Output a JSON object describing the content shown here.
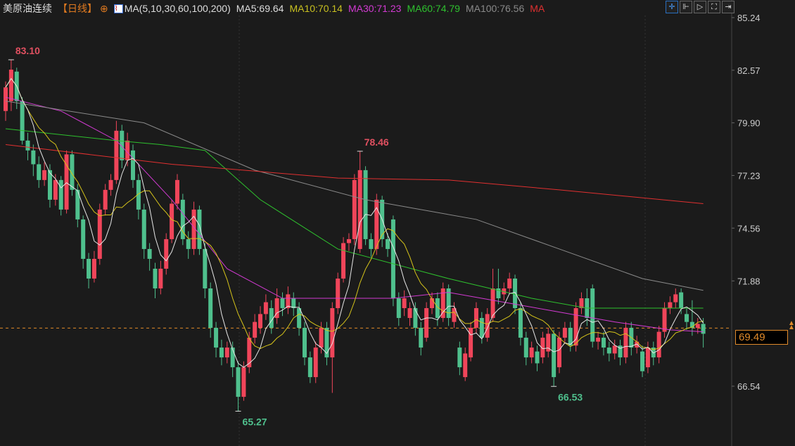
{
  "header": {
    "title": "美原油连续",
    "period": "【日线】",
    "ma_label": "MA(5,10,30,60,100,200)",
    "ma5": "MA5:69.64",
    "ma10": "MA10:70.14",
    "ma30": "MA30:71.23",
    "ma60": "MA60:74.79",
    "ma100": "MA100:76.56",
    "ma200": "MA"
  },
  "colors": {
    "up": "#f0455a",
    "down": "#4fc08d",
    "ma5": "#e6e6e6",
    "ma10": "#d6c41a",
    "ma30": "#d23ad2",
    "ma60": "#2ec02e",
    "ma100": "#8a8a8a",
    "ma200": "#e03030",
    "price": "#e08a2a"
  },
  "toolbar": [
    "crosshair-icon",
    "zoom-in-icon",
    "play-icon",
    "fullscreen-icon",
    "exit-icon"
  ],
  "current_price": "69.49",
  "chart_data": {
    "type": "candlestick",
    "yticks": [
      "85.24",
      "82.57",
      "79.90",
      "77.23",
      "74.56",
      "71.88",
      "69.49",
      "66.54"
    ],
    "ylim": [
      66.54,
      85.24
    ],
    "annotations": [
      {
        "idx": 1,
        "text": "83.10",
        "pos": "high"
      },
      {
        "idx": 64,
        "text": "78.46",
        "pos": "high"
      },
      {
        "idx": 42,
        "text": "65.27",
        "pos": "low"
      },
      {
        "idx": 99,
        "text": "66.53",
        "pos": "low"
      }
    ],
    "ohlc": [
      [
        80.5,
        81.7,
        82,
        80
      ],
      [
        81,
        82.6,
        83.1,
        80.5
      ],
      [
        82.5,
        81,
        82.7,
        80.6
      ],
      [
        81,
        79,
        81.2,
        78.8
      ],
      [
        79,
        78.5,
        79.4,
        78
      ],
      [
        78.5,
        77.8,
        78.8,
        77.2
      ],
      [
        77.8,
        77,
        78.2,
        76.6
      ],
      [
        77,
        77.5,
        77.9,
        76.7
      ],
      [
        77.5,
        76,
        77.8,
        75.6
      ],
      [
        76,
        77,
        77.3,
        75.7
      ],
      [
        77,
        75.5,
        77.2,
        75.2
      ],
      [
        75.5,
        78.3,
        78.5,
        75.3
      ],
      [
        78.3,
        76.5,
        78.5,
        76.2
      ],
      [
        76.5,
        75,
        76.8,
        74.6
      ],
      [
        75,
        73,
        75.2,
        72.5
      ],
      [
        73,
        72,
        73.3,
        71.5
      ],
      [
        72,
        73,
        73.4,
        71.8
      ],
      [
        73,
        75.5,
        75.8,
        72.7
      ],
      [
        75.5,
        76.5,
        76.8,
        75.2
      ],
      [
        76.5,
        77,
        77.3,
        76.2
      ],
      [
        77,
        79.5,
        80,
        76.8
      ],
      [
        79.5,
        78,
        79.8,
        77.6
      ],
      [
        78,
        79,
        79.4,
        77.7
      ],
      [
        78.5,
        77,
        78.8,
        76.6
      ],
      [
        77,
        75.5,
        77.3,
        75
      ],
      [
        75.5,
        73.5,
        75.8,
        73
      ],
      [
        73.5,
        73,
        73.8,
        72.4
      ],
      [
        72.5,
        71.5,
        72.8,
        71
      ],
      [
        71.5,
        72.5,
        72.9,
        71.2
      ],
      [
        72.5,
        74,
        74.3,
        72.2
      ],
      [
        74,
        75.8,
        76,
        73.8
      ],
      [
        75.8,
        77,
        77.3,
        75.5
      ],
      [
        76,
        74,
        76.3,
        73.7
      ],
      [
        74,
        73.5,
        74.4,
        73
      ],
      [
        73.5,
        75.5,
        75.9,
        73.2
      ],
      [
        75.5,
        73.5,
        75.7,
        73.2
      ],
      [
        73.5,
        71.5,
        73.8,
        71
      ],
      [
        71.5,
        69.5,
        71.8,
        69
      ],
      [
        69.5,
        68.5,
        69.8,
        68
      ],
      [
        68.5,
        68,
        68.9,
        67.6
      ],
      [
        68,
        68.5,
        68.8,
        67.7
      ],
      [
        68.5,
        67.5,
        68.8,
        67
      ],
      [
        67.5,
        66,
        67.8,
        65.27
      ],
      [
        66,
        67.5,
        67.8,
        65.8
      ],
      [
        67.5,
        69,
        69.3,
        67.2
      ],
      [
        69,
        69.8,
        70.2,
        68.7
      ],
      [
        69.5,
        70.2,
        70.6,
        69.2
      ],
      [
        70.2,
        70.8,
        71.2,
        69.9
      ],
      [
        70.5,
        69.5,
        70.9,
        69.2
      ],
      [
        70,
        71,
        71.5,
        69.7
      ],
      [
        71,
        70.5,
        71.3,
        70.1
      ],
      [
        70.5,
        71.2,
        71.6,
        70.2
      ],
      [
        71,
        70.5,
        71.3,
        70.1
      ],
      [
        70.5,
        69.5,
        70.8,
        69.1
      ],
      [
        69.5,
        68,
        69.8,
        67.6
      ],
      [
        68,
        67,
        68.3,
        66.7
      ],
      [
        67,
        68.5,
        68.8,
        66.7
      ],
      [
        68.5,
        69.5,
        69.8,
        68.2
      ],
      [
        69.5,
        68,
        69.8,
        67.6
      ],
      [
        68,
        70.5,
        70.8,
        66.2
      ],
      [
        70.5,
        72,
        72.3,
        70.2
      ],
      [
        72,
        73.8,
        74.1,
        71.8
      ],
      [
        73.8,
        74,
        74.3,
        73.4
      ],
      [
        74,
        77,
        77.3,
        73.7
      ],
      [
        73.5,
        77.5,
        78.46,
        73.3
      ],
      [
        77.5,
        74,
        77.7,
        73.7
      ],
      [
        74,
        73.5,
        74.3,
        73.1
      ],
      [
        73.5,
        76,
        76.3,
        73.2
      ],
      [
        76,
        74,
        76.2,
        73.6
      ],
      [
        74,
        73.5,
        74.3,
        73.1
      ],
      [
        75,
        71,
        75.2,
        70.6
      ],
      [
        71,
        70,
        71.3,
        69.6
      ],
      [
        70.5,
        71,
        71.4,
        70.1
      ],
      [
        70,
        70.5,
        70.8,
        69.6
      ],
      [
        70.5,
        69.5,
        70.8,
        69.1
      ],
      [
        69.5,
        68.5,
        69.8,
        68.1
      ],
      [
        69,
        70.5,
        70.8,
        68.8
      ],
      [
        70.5,
        71,
        71.3,
        70.2
      ],
      [
        71,
        70,
        71.3,
        69.6
      ],
      [
        70,
        71.5,
        71.8,
        69.8
      ],
      [
        71.5,
        70,
        71.7,
        69.6
      ],
      [
        69.8,
        70.5,
        70.8,
        69.5
      ],
      [
        68.5,
        67.5,
        68.8,
        67.1
      ],
      [
        67,
        68.2,
        68.5,
        66.8
      ],
      [
        68,
        69.5,
        69.8,
        67.8
      ],
      [
        69.5,
        70.5,
        70.8,
        69.2
      ],
      [
        70,
        69,
        70.3,
        68.7
      ],
      [
        69,
        70.2,
        70.5,
        68.8
      ],
      [
        70,
        71.5,
        72.5,
        69.8
      ],
      [
        71.5,
        71,
        72.5,
        70.7
      ],
      [
        71.2,
        71.5,
        71.8,
        70.9
      ],
      [
        71.5,
        72,
        72.3,
        71.2
      ],
      [
        72,
        70.5,
        72.2,
        70.2
      ],
      [
        70.5,
        69,
        70.8,
        68.6
      ],
      [
        69,
        68,
        69.3,
        67.6
      ],
      [
        68,
        68.5,
        68.8,
        67.7
      ],
      [
        68.3,
        67.7,
        68.6,
        67.3
      ],
      [
        68,
        69,
        69.3,
        67.7
      ],
      [
        68.3,
        69.2,
        69.5,
        68
      ],
      [
        69.2,
        67,
        69.4,
        66.53
      ],
      [
        67.5,
        69,
        69.3,
        67.2
      ],
      [
        69,
        69.5,
        69.8,
        68.7
      ],
      [
        69.5,
        68.6,
        69.8,
        68.3
      ],
      [
        68.6,
        70.5,
        70.8,
        68.3
      ],
      [
        70.5,
        71,
        71.3,
        70.2
      ],
      [
        71,
        70,
        71.5,
        69.6
      ],
      [
        71.5,
        68.8,
        71.7,
        68.5
      ],
      [
        68.8,
        69,
        69.3,
        68.4
      ],
      [
        69,
        68.5,
        69.3,
        68.1
      ],
      [
        68.5,
        68.2,
        68.8,
        67.8
      ],
      [
        68.2,
        68.6,
        68.9,
        67.9
      ],
      [
        68.6,
        68,
        68.9,
        67.6
      ],
      [
        68,
        69.5,
        69.8,
        67.7
      ],
      [
        69.5,
        68.5,
        69.8,
        68.1
      ],
      [
        68.5,
        68.8,
        69.1,
        68.2
      ],
      [
        68.3,
        67.3,
        68.6,
        67
      ],
      [
        67.5,
        68.5,
        68.8,
        67.2
      ],
      [
        68.5,
        68,
        68.8,
        67.6
      ],
      [
        68,
        69.3,
        69.6,
        67.7
      ],
      [
        69.3,
        70.5,
        70.8,
        69
      ],
      [
        70.5,
        70.8,
        71.1,
        70.2
      ],
      [
        70.8,
        71.2,
        71.5,
        70.5
      ],
      [
        71.3,
        70.5,
        71.5,
        70.2
      ],
      [
        70.2,
        69.8,
        70.5,
        69.4
      ],
      [
        69.8,
        69.5,
        70.9,
        69.1
      ],
      [
        69.5,
        69.7,
        70,
        69.2
      ],
      [
        69.7,
        69.2,
        70,
        68.5
      ]
    ],
    "ma_series": [
      {
        "name": "MA30",
        "color_key": "ma30",
        "points": [
          [
            0,
            81.2
          ],
          [
            10,
            80.5
          ],
          [
            20,
            79
          ],
          [
            30,
            76
          ],
          [
            40,
            72.5
          ],
          [
            50,
            71
          ],
          [
            60,
            71
          ],
          [
            70,
            71
          ],
          [
            80,
            71.3
          ],
          [
            90,
            70.8
          ],
          [
            100,
            70.3
          ],
          [
            110,
            69.8
          ],
          [
            120,
            69.4
          ],
          [
            126,
            69.3
          ]
        ]
      },
      {
        "name": "MA60",
        "color_key": "ma60",
        "points": [
          [
            0,
            79.6
          ],
          [
            20,
            79
          ],
          [
            28,
            78.8
          ],
          [
            36,
            78.5
          ],
          [
            46,
            76
          ],
          [
            60,
            73.5
          ],
          [
            80,
            72
          ],
          [
            95,
            71
          ],
          [
            105,
            70.5
          ],
          [
            126,
            70.5
          ]
        ]
      },
      {
        "name": "MA100",
        "color_key": "ma100",
        "points": [
          [
            0,
            81
          ],
          [
            25,
            79.9
          ],
          [
            45,
            77.5
          ],
          [
            65,
            76
          ],
          [
            85,
            75
          ],
          [
            100,
            73.5
          ],
          [
            115,
            72
          ],
          [
            126,
            71.4
          ]
        ]
      },
      {
        "name": "MA200",
        "color_key": "ma200",
        "points": [
          [
            0,
            78.8
          ],
          [
            30,
            77.8
          ],
          [
            60,
            77.1
          ],
          [
            80,
            77
          ],
          [
            100,
            76.5
          ],
          [
            126,
            75.8
          ]
        ]
      }
    ]
  }
}
